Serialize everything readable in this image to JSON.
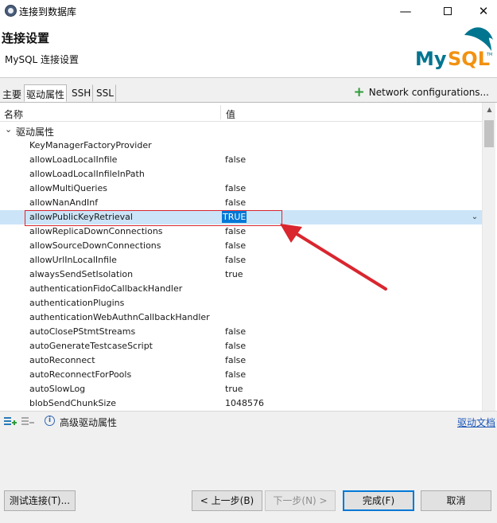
{
  "window": {
    "title": "连接到数据库",
    "minimize_icon": "minimize-icon",
    "maximize_icon": "maximize-icon",
    "close_icon": "close-icon"
  },
  "header": {
    "title": "连接设置",
    "subtitle": "MySQL 连接设置",
    "logo_text": "MySQL",
    "logo_mark": "TM"
  },
  "tabs": [
    {
      "label": "主要",
      "active": false
    },
    {
      "label": "驱动属性",
      "active": true
    },
    {
      "label": "SSH",
      "active": false
    },
    {
      "label": "SSL",
      "active": false
    }
  ],
  "network_config": {
    "label": "Network configurations..."
  },
  "table": {
    "col_name": "名称",
    "col_value": "值",
    "group_label": "驱动属性",
    "rows": [
      {
        "name": "KeyManagerFactoryProvider",
        "value": ""
      },
      {
        "name": "allowLoadLocalInfile",
        "value": "false"
      },
      {
        "name": "allowLoadLocalInfileInPath",
        "value": ""
      },
      {
        "name": "allowMultiQueries",
        "value": "false"
      },
      {
        "name": "allowNanAndInf",
        "value": "false"
      },
      {
        "name": "allowPublicKeyRetrieval",
        "value": "TRUE",
        "selected": true
      },
      {
        "name": "allowReplicaDownConnections",
        "value": "false"
      },
      {
        "name": "allowSourceDownConnections",
        "value": "false"
      },
      {
        "name": "allowUrlInLocalInfile",
        "value": "false"
      },
      {
        "name": "alwaysSendSetIsolation",
        "value": "true"
      },
      {
        "name": "authenticationFidoCallbackHandler",
        "value": ""
      },
      {
        "name": "authenticationPlugins",
        "value": ""
      },
      {
        "name": "authenticationWebAuthnCallbackHandler",
        "value": ""
      },
      {
        "name": "autoClosePStmtStreams",
        "value": "false"
      },
      {
        "name": "autoGenerateTestcaseScript",
        "value": "false"
      },
      {
        "name": "autoReconnect",
        "value": "false"
      },
      {
        "name": "autoReconnectForPools",
        "value": "false"
      },
      {
        "name": "autoSlowLog",
        "value": "true"
      },
      {
        "name": "blobSendChunkSize",
        "value": "1048576"
      }
    ]
  },
  "toolbar": {
    "advanced_label": "高级驱动属性",
    "driver_doc_link": "驱动文档"
  },
  "footer": {
    "test_button": "测试连接(T)...",
    "prev_button": "< 上一步(B)",
    "next_button": "下一步(N) >",
    "finish_button": "完成(F)",
    "cancel_button": "取消"
  },
  "colors": {
    "selection": "#cce4f7",
    "value_highlight": "#0078d7",
    "annotation_red": "#d9262f",
    "mysql_blue": "#00758f",
    "mysql_orange": "#f29111"
  }
}
